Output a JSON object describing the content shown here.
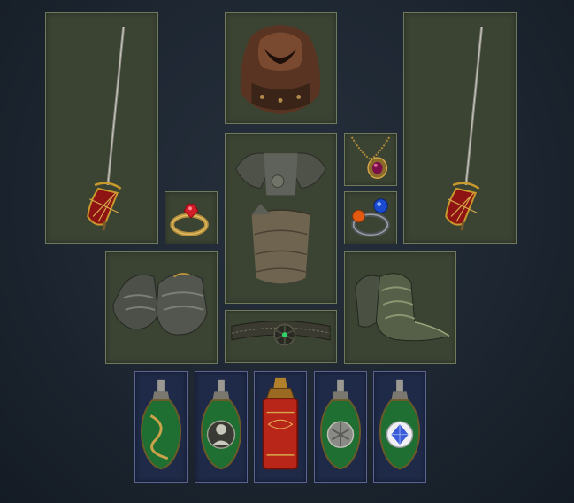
{
  "equipment": {
    "weapon_main": "rapier",
    "helmet": "bear-pelt-helm",
    "weapon_offhand": "rapier",
    "ring_left": "ruby-ring",
    "body_armour": "plate-armour",
    "amulet": "amulet",
    "ring_right": "sapphire-ring",
    "gloves": "plate-gauntlets",
    "belt": "belt",
    "boots": "plate-boots"
  },
  "flasks": [
    "life-flask",
    "life-flask",
    "utility-flask",
    "life-flask",
    "mana-flask"
  ],
  "colors": {
    "background": "#1d2631",
    "slot_fill": "#3b4333",
    "slot_border": "#6f7a5c",
    "flask_fill": "#1f2a48",
    "flask_border": "#5b6390"
  }
}
